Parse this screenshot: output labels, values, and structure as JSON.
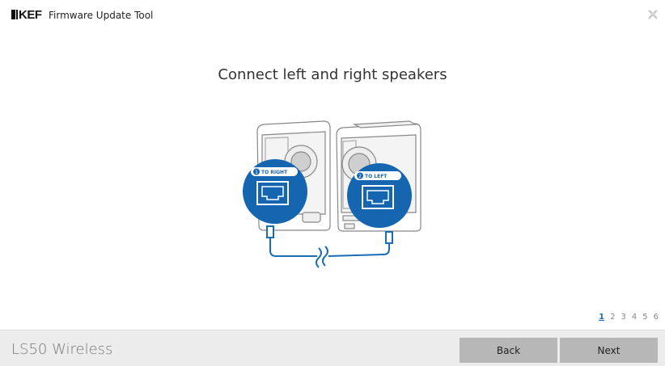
{
  "titlebar": {
    "logo_text": "KEF",
    "title": "Firmware Update Tool"
  },
  "main": {
    "heading": "Connect left and right speakers",
    "callouts": {
      "right_label": "TO RIGHT",
      "right_num": "1",
      "left_label": "TO LEFT",
      "left_num": "2"
    }
  },
  "pager": {
    "pages": [
      "1",
      "2",
      "3",
      "4",
      "5",
      "6"
    ],
    "active": "1"
  },
  "footer": {
    "product": "LS50 Wireless",
    "back_label": "Back",
    "next_label": "Next"
  },
  "colors": {
    "accent": "#1a6db5",
    "button": "#b7b7b7",
    "footer_bg": "#ececec"
  }
}
